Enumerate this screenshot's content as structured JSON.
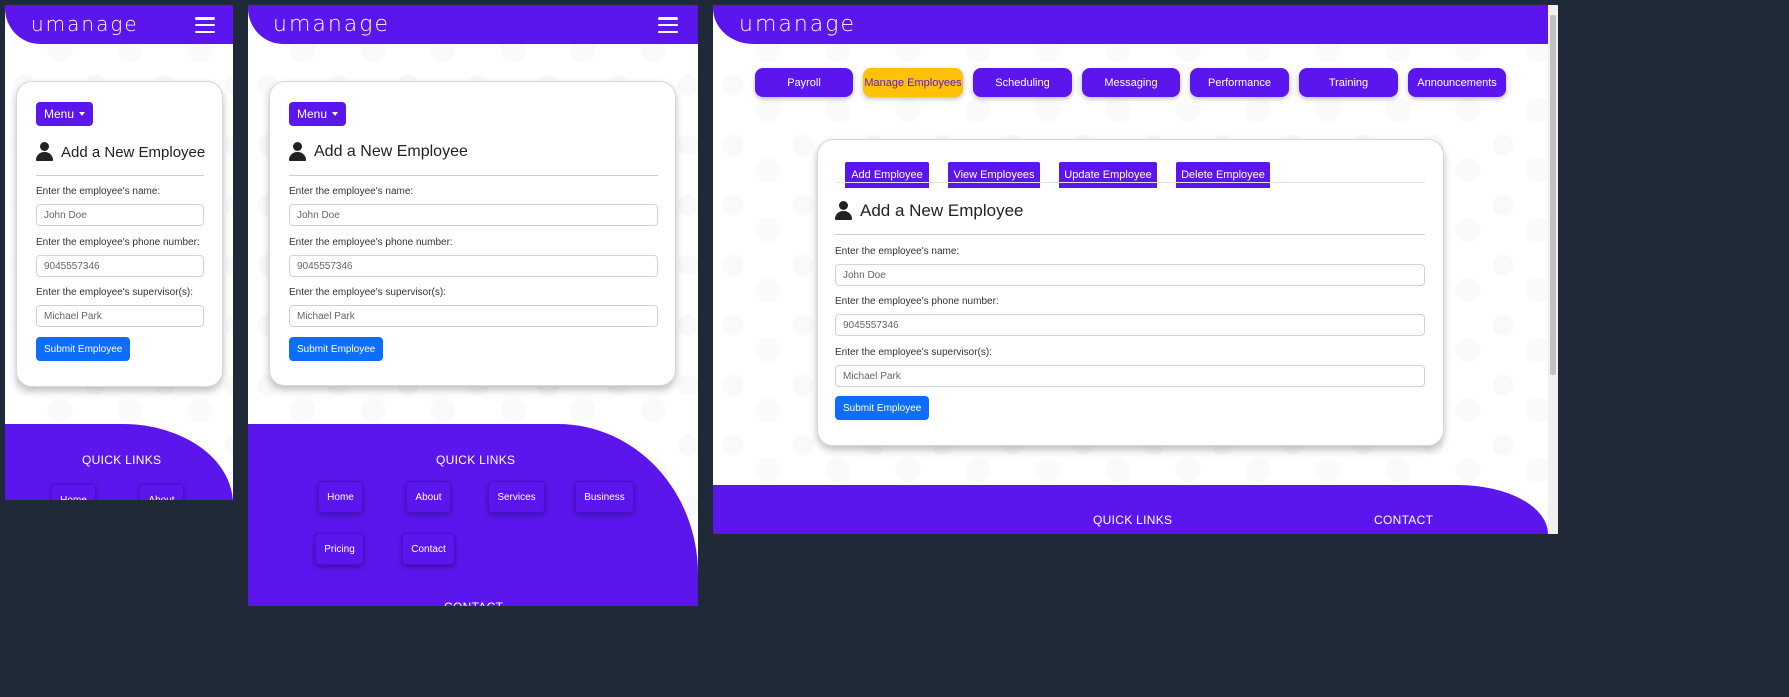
{
  "app": {
    "logo": "umanage"
  },
  "menu": {
    "label": "Menu"
  },
  "form": {
    "title": "Add a New Employee",
    "name_label": "Enter the employee's name:",
    "name_value": "John Doe",
    "phone_label": "Enter the employee's phone number:",
    "phone_value": "9045557346",
    "supervisor_label": "Enter the employee's supervisor(s):",
    "supervisor_value": "Michael Park",
    "submit_label": "Submit Employee"
  },
  "nav": {
    "items": [
      "Payroll",
      "Manage Employees",
      "Scheduling",
      "Messaging",
      "Performance",
      "Training",
      "Announcements"
    ],
    "active": "Manage Employees",
    "active_color": "#ffc107"
  },
  "tabs": [
    "Add Employee",
    "View Employees",
    "Update Employee",
    "Delete Employee"
  ],
  "footer": {
    "quick_links_title": "QUICK LINKS",
    "contact_title": "CONTACT",
    "links": [
      "Home",
      "About",
      "Services",
      "Business",
      "Pricing",
      "Contact"
    ]
  },
  "colors": {
    "brand": "#5b16ee",
    "primary": "#0d6efd",
    "background": "#1f2937"
  }
}
